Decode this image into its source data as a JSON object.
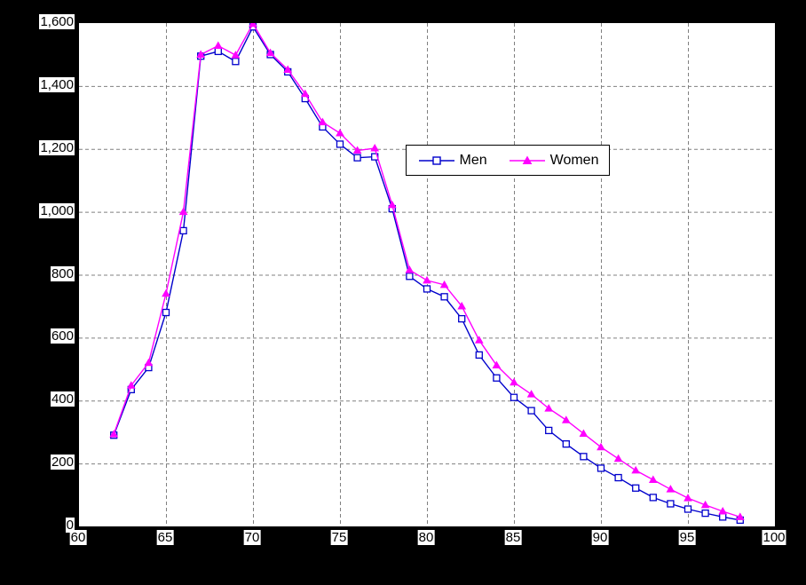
{
  "chart_data": {
    "type": "line",
    "title": "",
    "xlabel": "",
    "ylabel": "",
    "xlim": [
      60,
      100
    ],
    "ylim": [
      0,
      1600
    ],
    "xticks": [
      "60",
      "65",
      "70",
      "75",
      "80",
      "85",
      "90",
      "95",
      "100"
    ],
    "xtick_values": [
      60,
      65,
      70,
      75,
      80,
      85,
      90,
      95,
      100
    ],
    "yticks": [
      "0",
      "200",
      "400",
      "600",
      "800",
      "1,000",
      "1,200",
      "1,400",
      "1,600"
    ],
    "ytick_values": [
      0,
      200,
      400,
      600,
      800,
      1000,
      1200,
      1400,
      1600
    ],
    "grid": true,
    "legend_position": "upper-center",
    "x": [
      62,
      63,
      64,
      65,
      66,
      67,
      68,
      69,
      70,
      71,
      72,
      73,
      74,
      75,
      76,
      77,
      78,
      79,
      80,
      81,
      82,
      83,
      84,
      85,
      86,
      87,
      88,
      89,
      90,
      91,
      92,
      93,
      94,
      95,
      96,
      97,
      98
    ],
    "series": [
      {
        "name": "Men",
        "color": "#0000CC",
        "marker": "square",
        "values": [
          290,
          435,
          505,
          680,
          940,
          1495,
          1510,
          1478,
          1588,
          1500,
          1445,
          1360,
          1270,
          1215,
          1172,
          1175,
          1010,
          795,
          755,
          730,
          660,
          545,
          472,
          410,
          368,
          305,
          262,
          222,
          185,
          155,
          122,
          92,
          72,
          55,
          42,
          30,
          20
        ]
      },
      {
        "name": "Women",
        "color": "#FF00FF",
        "marker": "triangle",
        "values": [
          293,
          448,
          520,
          740,
          1000,
          1500,
          1528,
          1498,
          1598,
          1505,
          1452,
          1375,
          1285,
          1250,
          1195,
          1202,
          1022,
          815,
          782,
          768,
          700,
          592,
          512,
          458,
          420,
          375,
          338,
          295,
          252,
          215,
          178,
          148,
          118,
          90,
          68,
          48,
          30
        ]
      }
    ]
  },
  "legend": {
    "entries": [
      {
        "label": "Men"
      },
      {
        "label": "Women"
      }
    ]
  },
  "axes": {
    "y_tick_labels": [
      "1,600",
      "1,400",
      "1,200",
      "1,000",
      "800",
      "600",
      "400",
      "200",
      "0"
    ],
    "x_tick_labels": [
      "60",
      "65",
      "70",
      "75",
      "80",
      "85",
      "90",
      "95",
      "100"
    ]
  }
}
